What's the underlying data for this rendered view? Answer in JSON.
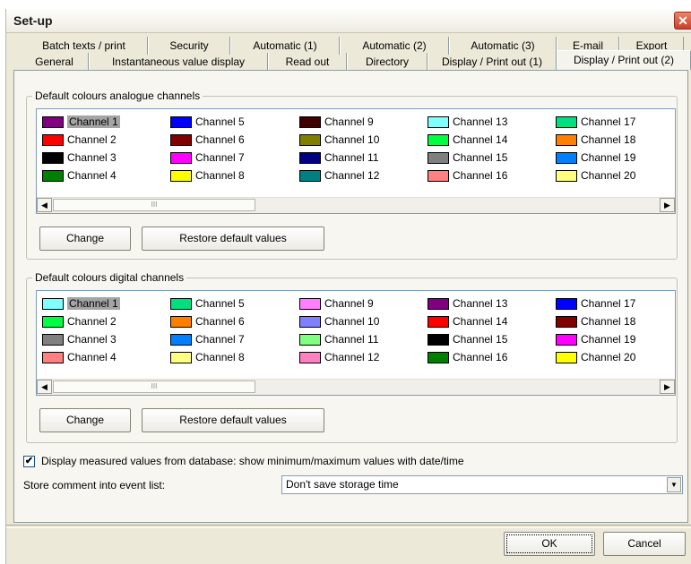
{
  "window": {
    "title": "Set-up",
    "close_glyph": "✕"
  },
  "tabs_row1": [
    {
      "label": "Batch texts / print",
      "underline": false
    },
    {
      "label": "Security"
    },
    {
      "label": "Automatic (1)"
    },
    {
      "label": "Automatic (2)"
    },
    {
      "label": "Automatic (3)"
    },
    {
      "label": "E-mail"
    },
    {
      "label": "Export"
    }
  ],
  "tabs_row2": [
    {
      "label": "General"
    },
    {
      "label": "Instantaneous value display"
    },
    {
      "label": "Read out"
    },
    {
      "label": "Directory"
    },
    {
      "label": "Display / Print out (1)"
    },
    {
      "label": "Display / Print out (2)"
    }
  ],
  "analogue": {
    "legend": "Default colours analogue channels",
    "columns": [
      [
        {
          "name": "Channel 1",
          "color": "#800080"
        },
        {
          "name": "Channel 2",
          "color": "#ff0000"
        },
        {
          "name": "Channel 3",
          "color": "#000000"
        },
        {
          "name": "Channel 4",
          "color": "#008000"
        }
      ],
      [
        {
          "name": "Channel 5",
          "color": "#0000ff"
        },
        {
          "name": "Channel 6",
          "color": "#800000"
        },
        {
          "name": "Channel 7",
          "color": "#ff00ff"
        },
        {
          "name": "Channel 8",
          "color": "#ffff00"
        }
      ],
      [
        {
          "name": "Channel 9",
          "color": "#400000"
        },
        {
          "name": "Channel 10",
          "color": "#808000"
        },
        {
          "name": "Channel 11",
          "color": "#000080"
        },
        {
          "name": "Channel 12",
          "color": "#008080"
        }
      ],
      [
        {
          "name": "Channel 13",
          "color": "#80ffff"
        },
        {
          "name": "Channel 14",
          "color": "#00ff40"
        },
        {
          "name": "Channel 15",
          "color": "#808080"
        },
        {
          "name": "Channel 16",
          "color": "#ff8080"
        }
      ],
      [
        {
          "name": "Channel 17",
          "color": "#00e080"
        },
        {
          "name": "Channel 18",
          "color": "#ff8000"
        },
        {
          "name": "Channel 19",
          "color": "#0080ff"
        },
        {
          "name": "Channel 20",
          "color": "#ffff80"
        }
      ]
    ],
    "change_label": "Change",
    "restore_label": "Restore default values"
  },
  "digital": {
    "legend": "Default colours digital channels",
    "columns": [
      [
        {
          "name": "Channel 1",
          "color": "#80ffff"
        },
        {
          "name": "Channel 2",
          "color": "#00ff40"
        },
        {
          "name": "Channel 3",
          "color": "#808080"
        },
        {
          "name": "Channel 4",
          "color": "#ff8080"
        }
      ],
      [
        {
          "name": "Channel 5",
          "color": "#00e080"
        },
        {
          "name": "Channel 6",
          "color": "#ff8000"
        },
        {
          "name": "Channel 7",
          "color": "#0080ff"
        },
        {
          "name": "Channel 8",
          "color": "#ffff80"
        }
      ],
      [
        {
          "name": "Channel 9",
          "color": "#ff80ff"
        },
        {
          "name": "Channel 10",
          "color": "#8080ff"
        },
        {
          "name": "Channel 11",
          "color": "#80ff80"
        },
        {
          "name": "Channel 12",
          "color": "#ff80c0"
        }
      ],
      [
        {
          "name": "Channel 13",
          "color": "#800080"
        },
        {
          "name": "Channel 14",
          "color": "#ff0000"
        },
        {
          "name": "Channel 15",
          "color": "#000000"
        },
        {
          "name": "Channel 16",
          "color": "#008000"
        }
      ],
      [
        {
          "name": "Channel 17",
          "color": "#0000ff"
        },
        {
          "name": "Channel 18",
          "color": "#800000"
        },
        {
          "name": "Channel 19",
          "color": "#ff00ff"
        },
        {
          "name": "Channel 20",
          "color": "#ffff00"
        }
      ]
    ],
    "change_label": "Change",
    "restore_label": "Restore default values"
  },
  "scroll": {
    "left_glyph": "◀",
    "right_glyph": "▶",
    "thumb_grip": "III"
  },
  "checkbox": {
    "checked": true,
    "mark": "✔",
    "label": "Display measured values from database: show minimum/maximum values with date/time"
  },
  "store_comment": {
    "label": "Store comment into event list:",
    "value": "Don't save storage time",
    "arrow": "▼"
  },
  "footer": {
    "ok_label": "OK",
    "cancel_label": "Cancel"
  }
}
